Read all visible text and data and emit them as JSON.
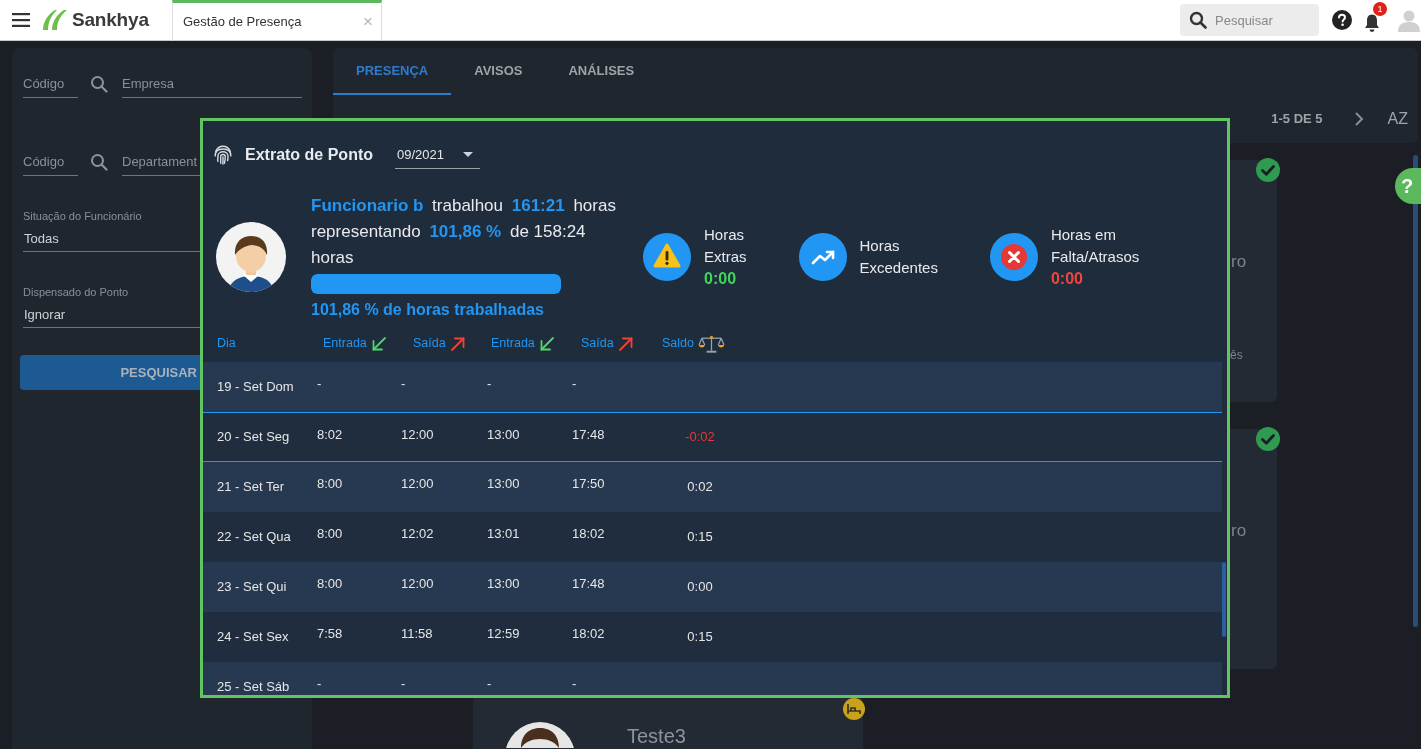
{
  "topbar": {
    "brand": "Sankhya",
    "tab": {
      "label": "Gestão de Presença",
      "close": "×",
      "selected": true
    },
    "search": {
      "placeholder": "Pesquisar"
    },
    "notifications": "1"
  },
  "filters": {
    "lookups": [
      {
        "code_placeholder": "Código",
        "name_placeholder": "Empresa"
      },
      {
        "code_placeholder": "Código",
        "name_placeholder": "Departament"
      }
    ],
    "selects": [
      {
        "label": "Situação do Funcionário",
        "value": "Todas"
      },
      {
        "label": "Dispensado do Ponto",
        "value": "Ignorar"
      }
    ],
    "button": "PESQUISAR"
  },
  "main": {
    "tabs": [
      {
        "label": "PRESENÇA",
        "selected": true
      },
      {
        "label": "AVISOS",
        "selected": false
      },
      {
        "label": "ANÁLISES",
        "selected": false
      }
    ],
    "pagination": "1-5 DE 5",
    "sort": "AZ",
    "cards": [
      {
        "texts": [
          "ro",
          "ês"
        ]
      },
      {
        "texts": [
          "ro"
        ]
      }
    ],
    "last_card": {
      "name": "Teste3"
    }
  },
  "help_button": "?",
  "modal": {
    "title": "Extrato de Ponto",
    "period": "09/2021",
    "summary": {
      "sentence": "**Funcionario b** trabalhou **161:21** horas representando **101,86 %** de 158:24 horas",
      "level": 1,
      "caption": "101,86 % de horas trabalhadas"
    },
    "stats": [
      {
        "kind": "extras",
        "label": "Horas\nExtras",
        "value": "0:00"
      },
      {
        "kind": "excess",
        "label": "Horas\nExcedentes"
      },
      {
        "kind": "missing",
        "label": "Horas em\nFalta/Atrasos",
        "value": "0:00"
      }
    ],
    "table": {
      "columns": [
        {
          "label": "Dia",
          "kind": "day"
        },
        {
          "label": "Entrada",
          "kind": "in"
        },
        {
          "label": "Saída",
          "kind": "out"
        },
        {
          "label": "Entrada",
          "kind": "in"
        },
        {
          "label": "Saída",
          "kind": "out"
        },
        {
          "label": "Saldo",
          "kind": "balance"
        }
      ],
      "rows": [
        {
          "day": "19 - Set Dom",
          "times": [
            "-",
            "-",
            "-",
            "-"
          ],
          "selected": false
        },
        {
          "day": "20 - Set Seg",
          "times": [
            "8:02",
            "12:00",
            "13:00",
            "17:48"
          ],
          "balance": {
            "text": "-0:02",
            "color": "#e53935"
          },
          "selected": true
        },
        {
          "day": "21 - Set Ter",
          "times": [
            "8:00",
            "12:00",
            "13:00",
            "17:50"
          ],
          "balance": {
            "text": "0:02",
            "color": "#e6e6e6"
          },
          "selected": false
        },
        {
          "day": "22 - Set Qua",
          "times": [
            "8:00",
            "12:02",
            "13:01",
            "18:02"
          ],
          "balance": {
            "text": "0:15",
            "color": "#e6e6e6"
          },
          "selected": false
        },
        {
          "day": "23 - Set Qui",
          "times": [
            "8:00",
            "12:00",
            "13:00",
            "17:48"
          ],
          "balance": {
            "text": "0:00",
            "color": "#e6e6e6"
          },
          "selected": false
        },
        {
          "day": "24 - Set Sex",
          "times": [
            "7:58",
            "11:58",
            "12:59",
            "18:02"
          ],
          "balance": {
            "text": "0:15",
            "color": "#e6e6e6"
          },
          "selected": false
        },
        {
          "day": "25 - Set Sáb",
          "times": [
            "-",
            "-",
            "-",
            "-"
          ],
          "selected": false
        }
      ]
    }
  }
}
